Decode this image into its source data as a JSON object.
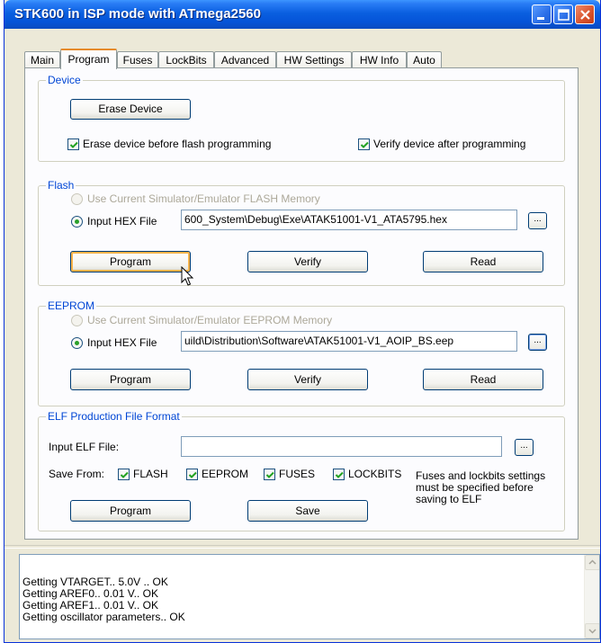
{
  "window": {
    "title": "STK600 in ISP mode with ATmega2560"
  },
  "tabs": [
    {
      "label": "Main"
    },
    {
      "label": "Program",
      "active": true
    },
    {
      "label": "Fuses"
    },
    {
      "label": "LockBits"
    },
    {
      "label": "Advanced"
    },
    {
      "label": "HW Settings"
    },
    {
      "label": "HW Info"
    },
    {
      "label": "Auto"
    }
  ],
  "device": {
    "legend": "Device",
    "erase_button": "Erase Device",
    "erase_before_flash": {
      "label": "Erase device before flash programming",
      "checked": true
    },
    "verify_after": {
      "label": "Verify device after programming",
      "checked": true
    }
  },
  "flash": {
    "legend": "Flash",
    "use_sim_label": "Use Current Simulator/Emulator FLASH Memory",
    "input_hex_label": "Input HEX File",
    "hex_path": "600_System\\Debug\\Exe\\ATAK51001-V1_ATA5795.hex",
    "browse_label": "...",
    "program_button": "Program",
    "verify_button": "Verify",
    "read_button": "Read"
  },
  "eeprom": {
    "legend": "EEPROM",
    "use_sim_label": "Use Current Simulator/Emulator EEPROM Memory",
    "input_hex_label": "Input HEX File",
    "hex_path": "uild\\Distribution\\Software\\ATAK51001-V1_AOIP_BS.eep",
    "browse_label": "...",
    "program_button": "Program",
    "verify_button": "Verify",
    "read_button": "Read"
  },
  "elf": {
    "legend": "ELF Production File Format",
    "input_label": "Input ELF File:",
    "input_value": "",
    "browse_label": "...",
    "save_from_label": "Save From:",
    "options": [
      {
        "label": "FLASH",
        "checked": true
      },
      {
        "label": "EEPROM",
        "checked": true
      },
      {
        "label": "FUSES",
        "checked": true
      },
      {
        "label": "LOCKBITS",
        "checked": true
      }
    ],
    "note": [
      "Fuses and lockbits settings",
      "must be specified before",
      "saving to ELF"
    ],
    "program_button": "Program",
    "save_button": "Save"
  },
  "log": {
    "lines": [
      "Getting VTARGET.. 5.0V .. OK",
      "Getting AREF0.. 0.01 V.. OK",
      "Getting AREF1.. 0.01 V.. OK",
      "Getting oscillator parameters.. OK"
    ]
  },
  "colors": {
    "title_bar": "#0554d8",
    "group_legend": "#0046d5",
    "check_mark": "#21a121",
    "active_tab_accent": "#e68b2c"
  },
  "icons": [
    "minimize-icon",
    "maximize-icon",
    "close-icon",
    "check-icon",
    "scroll-up-icon",
    "scroll-down-icon",
    "mouse-pointer-icon"
  ]
}
